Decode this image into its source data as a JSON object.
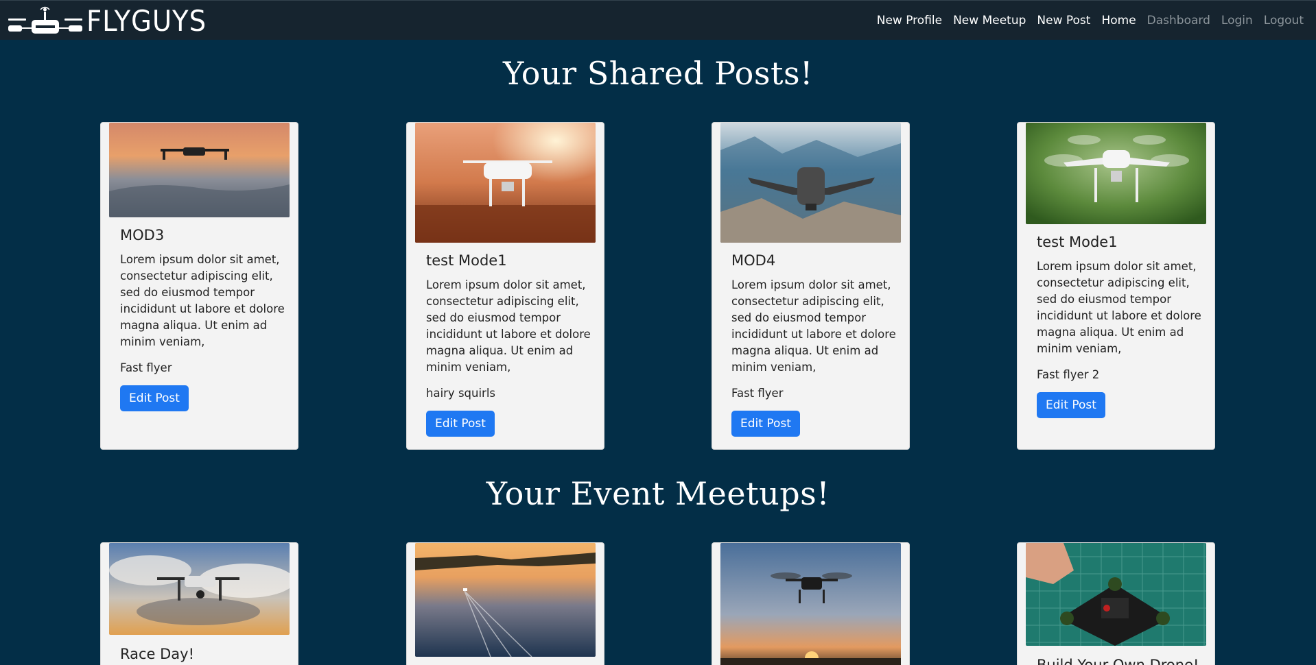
{
  "brand": {
    "name": "FLYGUYS"
  },
  "nav": {
    "items": [
      {
        "label": "New Profile"
      },
      {
        "label": "New Meetup"
      },
      {
        "label": "New Post"
      },
      {
        "label": "Home"
      },
      {
        "label": "Dashboard"
      },
      {
        "label": "Login"
      },
      {
        "label": "Logout"
      }
    ]
  },
  "posts_section": {
    "title": "Your Shared Posts!",
    "cards": [
      {
        "title": "MOD3",
        "text": "Lorem ipsum dolor sit amet, consectetur adipiscing elit, sed do eiusmod tempor incididunt ut labore et dolore magna aliqua. Ut enim ad minim veniam,",
        "name": "Fast flyer",
        "button": "Edit Post"
      },
      {
        "title": "test Mode1",
        "text": "Lorem ipsum dolor sit amet, consectetur adipiscing elit, sed do eiusmod tempor incididunt ut labore et dolore magna aliqua. Ut enim ad minim veniam,",
        "name": "hairy squirls",
        "button": "Edit Post"
      },
      {
        "title": "MOD4",
        "text": "Lorem ipsum dolor sit amet, consectetur adipiscing elit, sed do eiusmod tempor incididunt ut labore et dolore magna aliqua. Ut enim ad minim veniam,",
        "name": "Fast flyer",
        "button": "Edit Post"
      },
      {
        "title": "test Mode1",
        "text": "Lorem ipsum dolor sit amet, consectetur adipiscing elit, sed do eiusmod tempor incididunt ut labore et dolore magna aliqua. Ut enim ad minim veniam,",
        "name": "Fast flyer 2",
        "button": "Edit Post"
      }
    ]
  },
  "meetups_section": {
    "title": "Your Event Meetups!",
    "cards": [
      {
        "title": "Race Day!"
      },
      {
        "title": ""
      },
      {
        "title": ""
      },
      {
        "title": "Build Your Own Drone!"
      }
    ]
  },
  "colors": {
    "background": "#032e47",
    "navbar": "#16242f",
    "button": "#1f78f2",
    "card": "#f3f3f3"
  }
}
